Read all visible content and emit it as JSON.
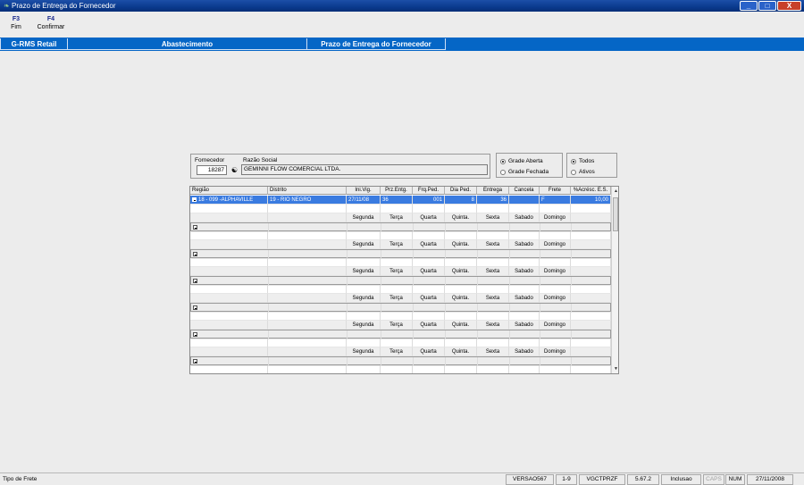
{
  "window": {
    "title": "Prazo de Entrega do Fornecedor",
    "min": "_",
    "max": "□",
    "close": "X"
  },
  "toolbar": [
    {
      "key": "F3",
      "label": "Fim"
    },
    {
      "key": "F4",
      "label": "Confirmar"
    }
  ],
  "breadcrumb": [
    "G-RMS Retail",
    "Abastecimento",
    "Prazo de Entrega do Fornecedor"
  ],
  "fornecedor": {
    "label": "Fornecedor",
    "code": "18287",
    "razao_label": "Razão Social",
    "razao": "GEMINNI FLOW COMERCIAL LTDA."
  },
  "grade": {
    "aberta": "Grade Aberta",
    "fechada": "Grade Fechada",
    "selected": "aberta"
  },
  "filtro": {
    "todos": "Todos",
    "ativos": "Ativos",
    "selected": "todos"
  },
  "grid": {
    "columns": [
      "Região",
      "Distrito",
      "Ini.Vig.",
      "Prz.Entg.",
      "Frq.Ped.",
      "Dia Ped.",
      "Entrega",
      "Cancela",
      "Frete",
      "%Acrésc. E.S."
    ],
    "selected_row": {
      "regiao": "18 - 099 -ALPHAVILLE",
      "distrito": "19 - RIO NEGRO",
      "ini_vig": "27/11/08",
      "prz_entg": "36",
      "frq_ped": "001",
      "dia_ped": "8",
      "entrega": "36",
      "cancela": "",
      "frete": "F",
      "acresc": "10,00"
    },
    "days": [
      "Segunda",
      "Terça",
      "Quarta",
      "Quinta.",
      "Sexta",
      "Sabado",
      "Domingo"
    ]
  },
  "status": {
    "left": "Tipo de Frete",
    "panes": [
      "VERSAO567",
      "1-9",
      "VGCTPRZF",
      "5.67.2",
      "Inclusao",
      "CAPS",
      "NUM",
      "27/11/2008"
    ]
  }
}
